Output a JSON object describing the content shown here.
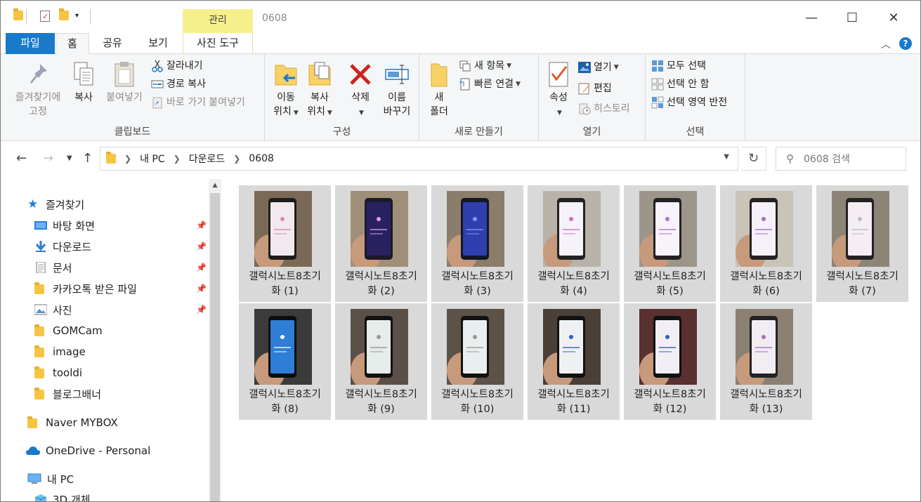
{
  "titlebar": {
    "context_tab": "관리",
    "title": "0608",
    "buttons": {
      "minimize": "—",
      "maximize": "☐",
      "close": "✕"
    }
  },
  "tabs": {
    "file": "파일",
    "home": "홈",
    "share": "공유",
    "view": "보기",
    "picture_tools": "사진 도구"
  },
  "ribbon": {
    "clipboard": {
      "label": "클립보드",
      "pin_line1": "즐겨찾기에",
      "pin_line2": "고정",
      "copy": "복사",
      "paste": "붙여넣기",
      "cut": "잘라내기",
      "copy_path": "경로 복사",
      "paste_shortcut": "바로 가기 붙여넣기"
    },
    "organize": {
      "label": "구성",
      "move_line1": "이동",
      "move_line2": "위치",
      "copy_line1": "복사",
      "copy_line2": "위치",
      "delete": "삭제",
      "rename_line1": "이름",
      "rename_line2": "바꾸기"
    },
    "new": {
      "label": "새로 만들기",
      "folder_line1": "새",
      "folder_line2": "폴더",
      "new_item": "새 항목",
      "easy_access": "빠른 연결"
    },
    "open": {
      "label": "열기",
      "properties": "속성",
      "open": "열기",
      "edit": "편집",
      "history": "히스토리"
    },
    "select": {
      "label": "선택",
      "select_all": "모두 선택",
      "select_none": "선택 안 함",
      "invert": "선택 영역 반전"
    }
  },
  "address": {
    "path": [
      "내 PC",
      "다운로드",
      "0608"
    ],
    "search_placeholder": "0608 검색"
  },
  "nav": {
    "quick_access": "즐겨찾기",
    "items": [
      {
        "label": "바탕 화면",
        "pinned": true
      },
      {
        "label": "다운로드",
        "pinned": true
      },
      {
        "label": "문서",
        "pinned": true
      },
      {
        "label": "카카오톡 받은 파일",
        "pinned": true
      },
      {
        "label": "사진",
        "pinned": true
      },
      {
        "label": "GOMCam",
        "pinned": false
      },
      {
        "label": "image",
        "pinned": false
      },
      {
        "label": "tooldi",
        "pinned": false
      },
      {
        "label": "블로그배너",
        "pinned": false
      }
    ],
    "mybox": "Naver MYBOX",
    "onedrive": "OneDrive - Personal",
    "this_pc": "내 PC",
    "objects3d": "3D 개체"
  },
  "files": [
    {
      "line1": "갤럭시노트8초기",
      "line2": "화 (1)"
    },
    {
      "line1": "갤럭시노트8초기",
      "line2": "화 (2)"
    },
    {
      "line1": "갤럭시노트8초기",
      "line2": "화 (3)"
    },
    {
      "line1": "갤럭시노트8초기",
      "line2": "화 (4)"
    },
    {
      "line1": "갤럭시노트8초기",
      "line2": "화 (5)"
    },
    {
      "line1": "갤럭시노트8초기",
      "line2": "화 (6)"
    },
    {
      "line1": "갤럭시노트8초기",
      "line2": "화 (7)"
    },
    {
      "line1": "갤럭시노트8초기",
      "line2": "화 (8)"
    },
    {
      "line1": "갤럭시노트8초기",
      "line2": "화 (9)"
    },
    {
      "line1": "갤럭시노트8초기",
      "line2": "화 (10)"
    },
    {
      "line1": "갤럭시노트8초기",
      "line2": "화 (11)"
    },
    {
      "line1": "갤럭시노트8초기",
      "line2": "화 (12)"
    },
    {
      "line1": "갤럭시노트8초기",
      "line2": "화 (13)"
    }
  ],
  "colors": {
    "accent": "#1979ca",
    "context_tab": "#f6f08c",
    "selected_tile": "#d9d9d9"
  }
}
